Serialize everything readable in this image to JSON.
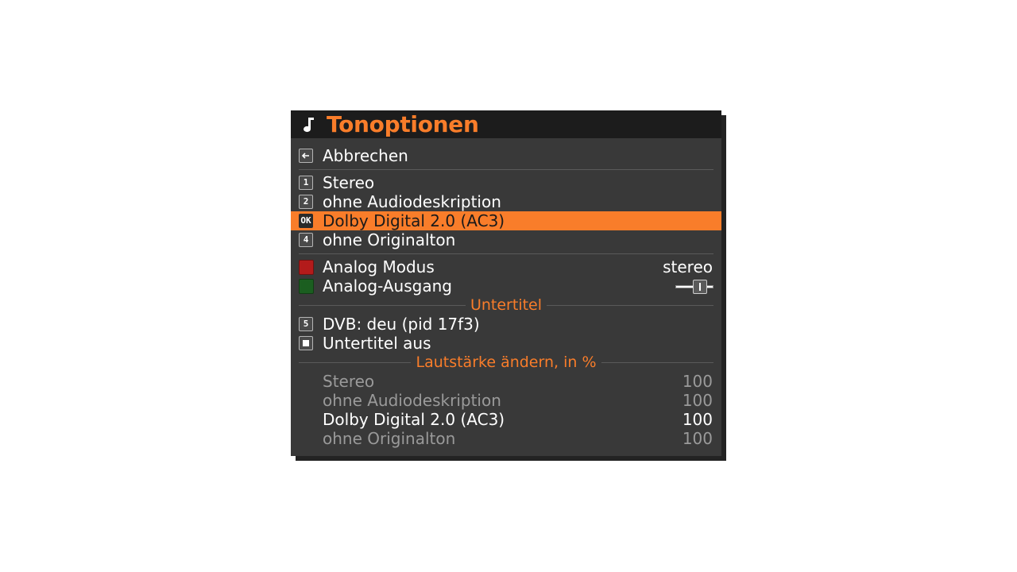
{
  "title": "Tonoptionen",
  "colors": {
    "accent": "#f97d2a",
    "background": "#393939",
    "titlebar": "#1c1c1c",
    "red": "#b31b1b",
    "green": "#1b5e20"
  },
  "cancel": {
    "key_icon": "arrow-left-icon",
    "label": "Abbrechen"
  },
  "audio_tracks": [
    {
      "key": "1",
      "label": "Stereo"
    },
    {
      "key": "2",
      "label": "ohne Audiodeskription"
    },
    {
      "key": "OK",
      "label": "Dolby Digital 2.0 (AC3)",
      "selected": true
    },
    {
      "key": "4",
      "label": "ohne Originalton"
    }
  ],
  "analog_mode": {
    "label": "Analog Modus",
    "value": "stereo"
  },
  "analog_output": {
    "label": "Analog-Ausgang",
    "level": 0.72
  },
  "subtitles": {
    "section_title": "Untertitel",
    "items": [
      {
        "key": "5",
        "label": "DVB: deu (pid 17f3)"
      },
      {
        "key_icon": "stop-icon",
        "label": "Untertitel aus"
      }
    ]
  },
  "volume": {
    "section_title": "Lautstärke ändern, in %",
    "items": [
      {
        "label": "Stereo",
        "value": "100",
        "active": false
      },
      {
        "label": "ohne Audiodeskription",
        "value": "100",
        "active": false
      },
      {
        "label": "Dolby Digital 2.0 (AC3)",
        "value": "100",
        "active": true
      },
      {
        "label": "ohne Originalton",
        "value": "100",
        "active": false
      }
    ]
  }
}
